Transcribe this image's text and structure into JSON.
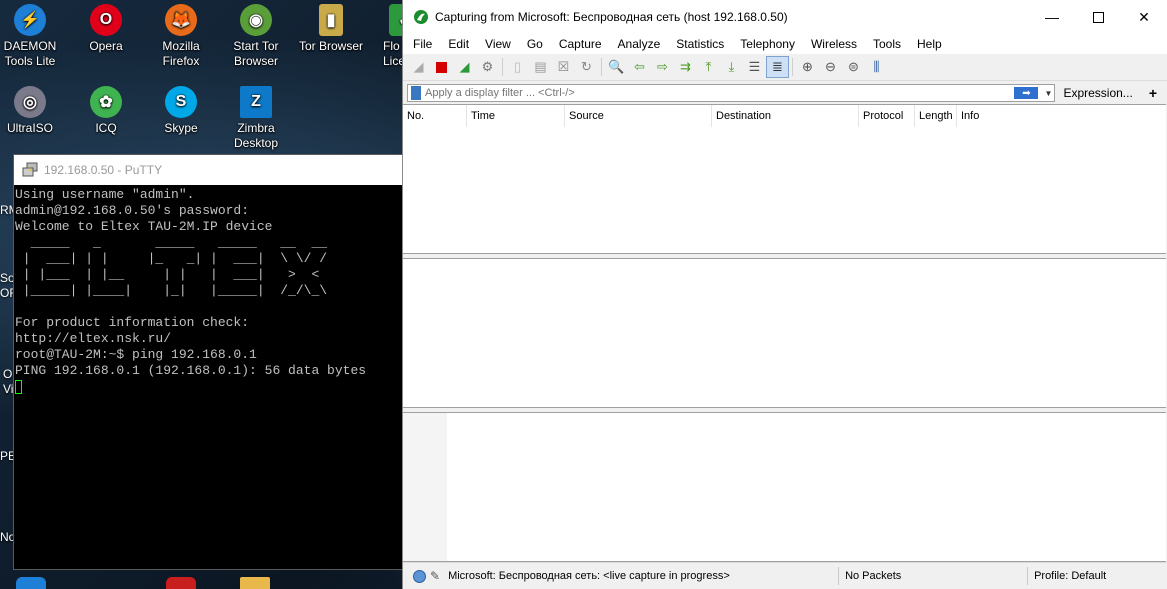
{
  "desktop": {
    "icons": [
      {
        "label1": "DAEMON",
        "label2": "Tools Lite",
        "color": "#1e7fd6",
        "glyph": "⚡"
      },
      {
        "label1": "Opera",
        "label2": "",
        "color": "#e0001a",
        "glyph": "O"
      },
      {
        "label1": "Mozilla",
        "label2": "Firefox",
        "color": "#e86a1a",
        "glyph": "🦊"
      },
      {
        "label1": "Start Tor",
        "label2": "Browser",
        "color": "#5a9e3a",
        "glyph": "◉"
      },
      {
        "label1": "Tor Browser",
        "label2": "",
        "color": "#c9a94a",
        "glyph": "▮"
      },
      {
        "label1": "Flo",
        "label2": "Lice",
        "color": "#2c9a3c",
        "glyph": "✓"
      },
      {
        "label1": "UltraISO",
        "label2": "",
        "color": "#7a7a8a",
        "glyph": "◎"
      },
      {
        "label1": "ICQ",
        "label2": "",
        "color": "#3fb34f",
        "glyph": "✿"
      },
      {
        "label1": "Skype",
        "label2": "",
        "color": "#00a8e8",
        "glyph": "S"
      },
      {
        "label1": "Zimbra",
        "label2": "Desktop",
        "color": "#0d79c8",
        "glyph": "Z"
      }
    ],
    "edge_labels": [
      "RM",
      "Sou",
      "ORI",
      "O",
      "Vi",
      "PB",
      "No"
    ]
  },
  "putty": {
    "title": "192.168.0.50 - PuTTY",
    "lines": [
      "Using username \"admin\".",
      "admin@192.168.0.50's password:",
      "Welcome to Eltex TAU-2M.IP device",
      "  _____   _       _____   _____   __  __",
      " |  ___| | |     |_   _| |  ___|  \\ \\/ /",
      " | |___  | |__     | |   |  ___|   >  <",
      " |_____| |____|    |_|   |_____|  /_/\\_\\",
      "",
      "For product information check:",
      "http://eltex.nsk.ru/",
      "root@TAU-2M:~$ ping 192.168.0.1",
      "PING 192.168.0.1 (192.168.0.1): 56 data bytes"
    ]
  },
  "wireshark": {
    "title": "Capturing from Microsoft: Беспроводная сеть (host 192.168.0.50)",
    "menu": [
      "File",
      "Edit",
      "View",
      "Go",
      "Capture",
      "Analyze",
      "Statistics",
      "Telephony",
      "Wireless",
      "Tools",
      "Help"
    ],
    "filter_placeholder": "Apply a display filter ... <Ctrl-/>",
    "expression_label": "Expression...",
    "plus_label": "+",
    "columns": [
      "No.",
      "Time",
      "Source",
      "Destination",
      "Protocol",
      "Length",
      "Info"
    ],
    "status": {
      "capture": "Microsoft: Беспроводная сеть: <live capture in progress>",
      "packets": "No Packets",
      "profile": "Profile: Default"
    }
  }
}
